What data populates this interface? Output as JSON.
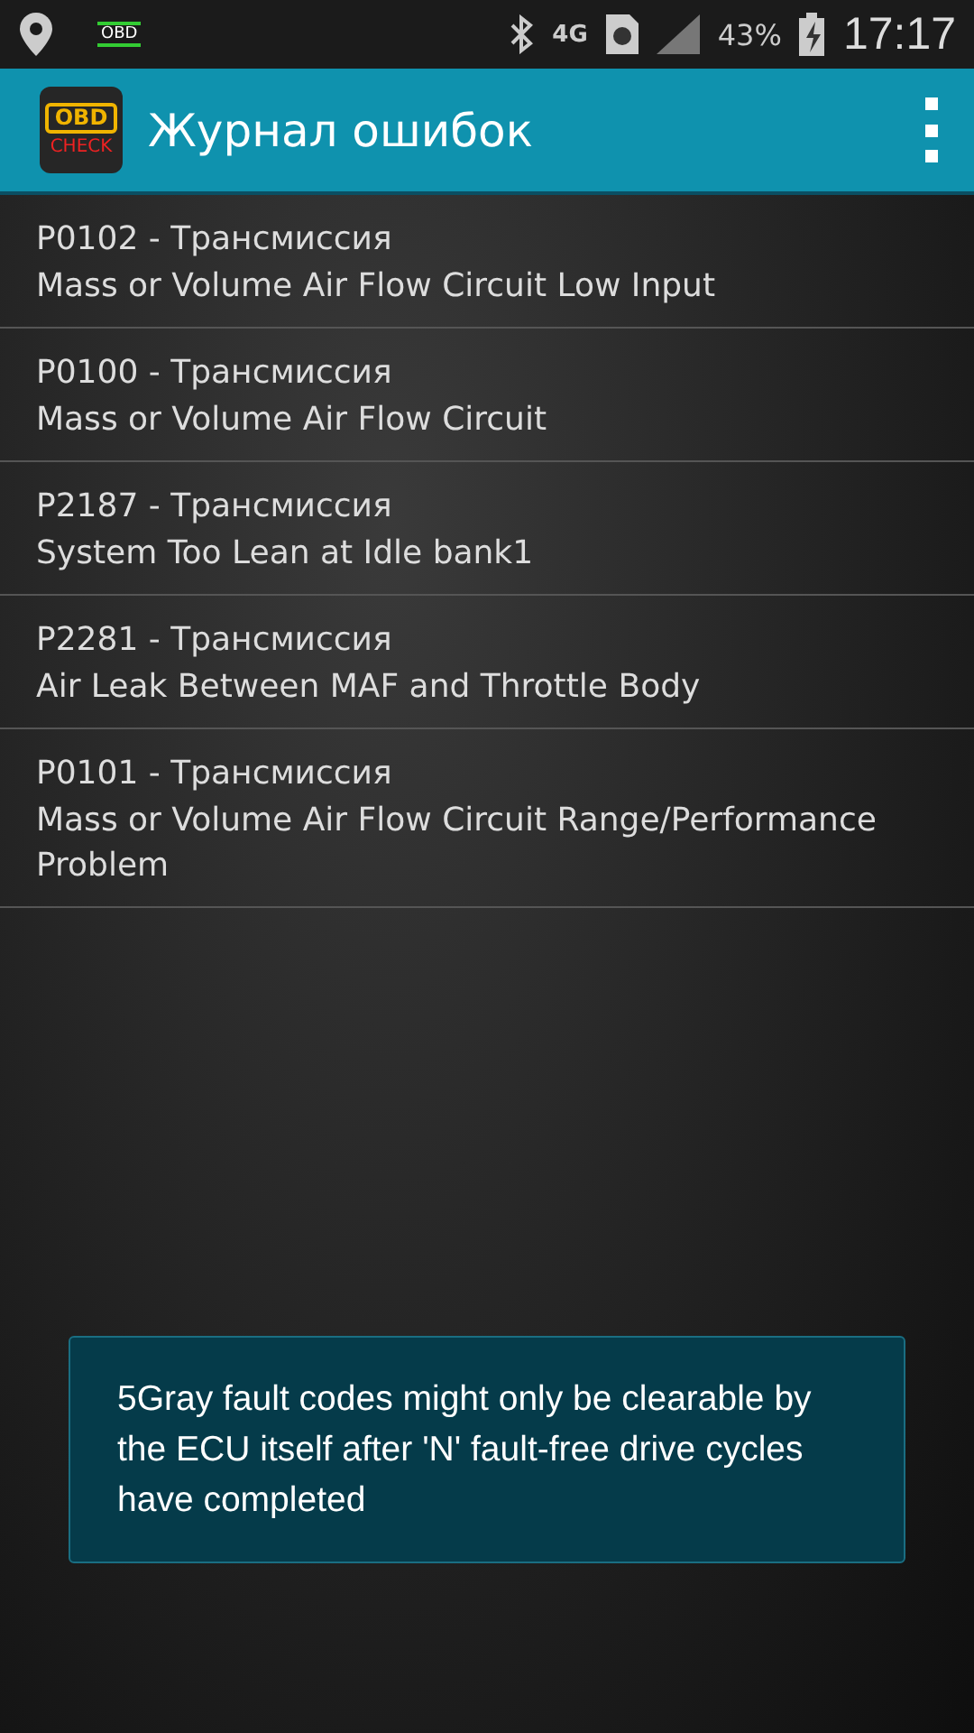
{
  "status_bar": {
    "app_badge": "OBD",
    "network": "4G",
    "battery": "43%",
    "time": "17:17"
  },
  "app_bar": {
    "logo_top": "OBD",
    "logo_bottom": "CHECK",
    "title": "Журнал ошибок"
  },
  "codes": [
    {
      "code": "P0102 - Трансмиссия",
      "description": "Mass or Volume Air Flow Circuit Low Input"
    },
    {
      "code": "P0100 - Трансмиссия",
      "description": "Mass or Volume Air Flow Circuit"
    },
    {
      "code": "P2187 - Трансмиссия",
      "description": "System Too Lean at Idle bank1"
    },
    {
      "code": "P2281 - Трансмиссия",
      "description": "Air Leak Between MAF and Throttle Body"
    },
    {
      "code": "P0101 - Трансмиссия",
      "description": "Mass or Volume Air Flow Circuit Range/Performance Problem"
    }
  ],
  "toast": "5Gray fault codes might only be clearable by the ECU itself after 'N' fault-free drive cycles have completed"
}
